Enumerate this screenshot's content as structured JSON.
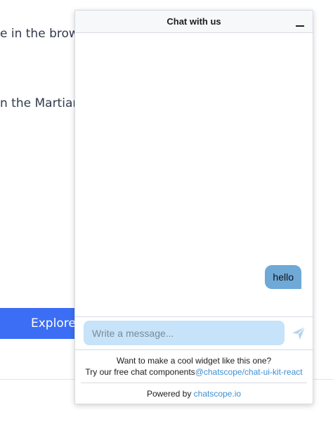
{
  "background": {
    "line1": "e in the brows",
    "line2": "n the Martian.",
    "explore_label": "Explore"
  },
  "chat": {
    "title": "Chat with us",
    "messages": [
      {
        "text": "hello",
        "direction": "outgoing"
      }
    ],
    "input": {
      "placeholder": "Write a message...",
      "value": ""
    },
    "promo": {
      "line1": "Want to make a cool widget like this one?",
      "line2_prefix": "Try our free chat components",
      "line2_link": "@chatscope/chat-ui-kit-react"
    },
    "powered": {
      "prefix": "Powered by ",
      "link": "chatscope.io"
    }
  },
  "colors": {
    "accent": "#3b6ef5",
    "bubble": "#6ea9d7",
    "input_bg": "#c6e3fa",
    "link": "#3d8fd1"
  },
  "icons": {
    "minimize": "minimize-icon",
    "send": "send-icon"
  }
}
